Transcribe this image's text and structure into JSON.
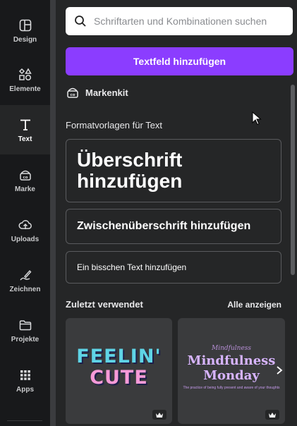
{
  "rail": {
    "items": [
      {
        "label": "Design",
        "icon": "layout-icon"
      },
      {
        "label": "Elemente",
        "icon": "shapes-icon"
      },
      {
        "label": "Text",
        "icon": "text-icon",
        "active": true
      },
      {
        "label": "Marke",
        "icon": "brand-icon"
      },
      {
        "label": "Uploads",
        "icon": "cloud-upload-icon"
      },
      {
        "label": "Zeichnen",
        "icon": "draw-icon"
      },
      {
        "label": "Projekte",
        "icon": "folder-icon"
      },
      {
        "label": "Apps",
        "icon": "apps-grid-icon"
      }
    ]
  },
  "search": {
    "placeholder": "Schriftarten und Kombinationen suchen"
  },
  "add_text_button": {
    "label": "Textfeld hinzufügen",
    "color": "#8b3dff"
  },
  "brand_kit": {
    "label": "Markenkit"
  },
  "format_section": {
    "title": "Formatvorlagen für Text",
    "heading": "Überschrift hinzufügen",
    "subheading": "Zwischenüberschrift hinzufügen",
    "body": "Ein bisschen Text hinzufügen"
  },
  "recent": {
    "title": "Zuletzt verwendet",
    "show_all": "Alle anzeigen",
    "items": [
      {
        "line1": "FEELIN'",
        "line2": "CUTE",
        "premium": true
      },
      {
        "top": "Mindfulness",
        "line1": "Mindfulness",
        "line2": "Monday",
        "small": "The practice of being fully present and aware of your thoughts",
        "premium": true
      }
    ]
  }
}
